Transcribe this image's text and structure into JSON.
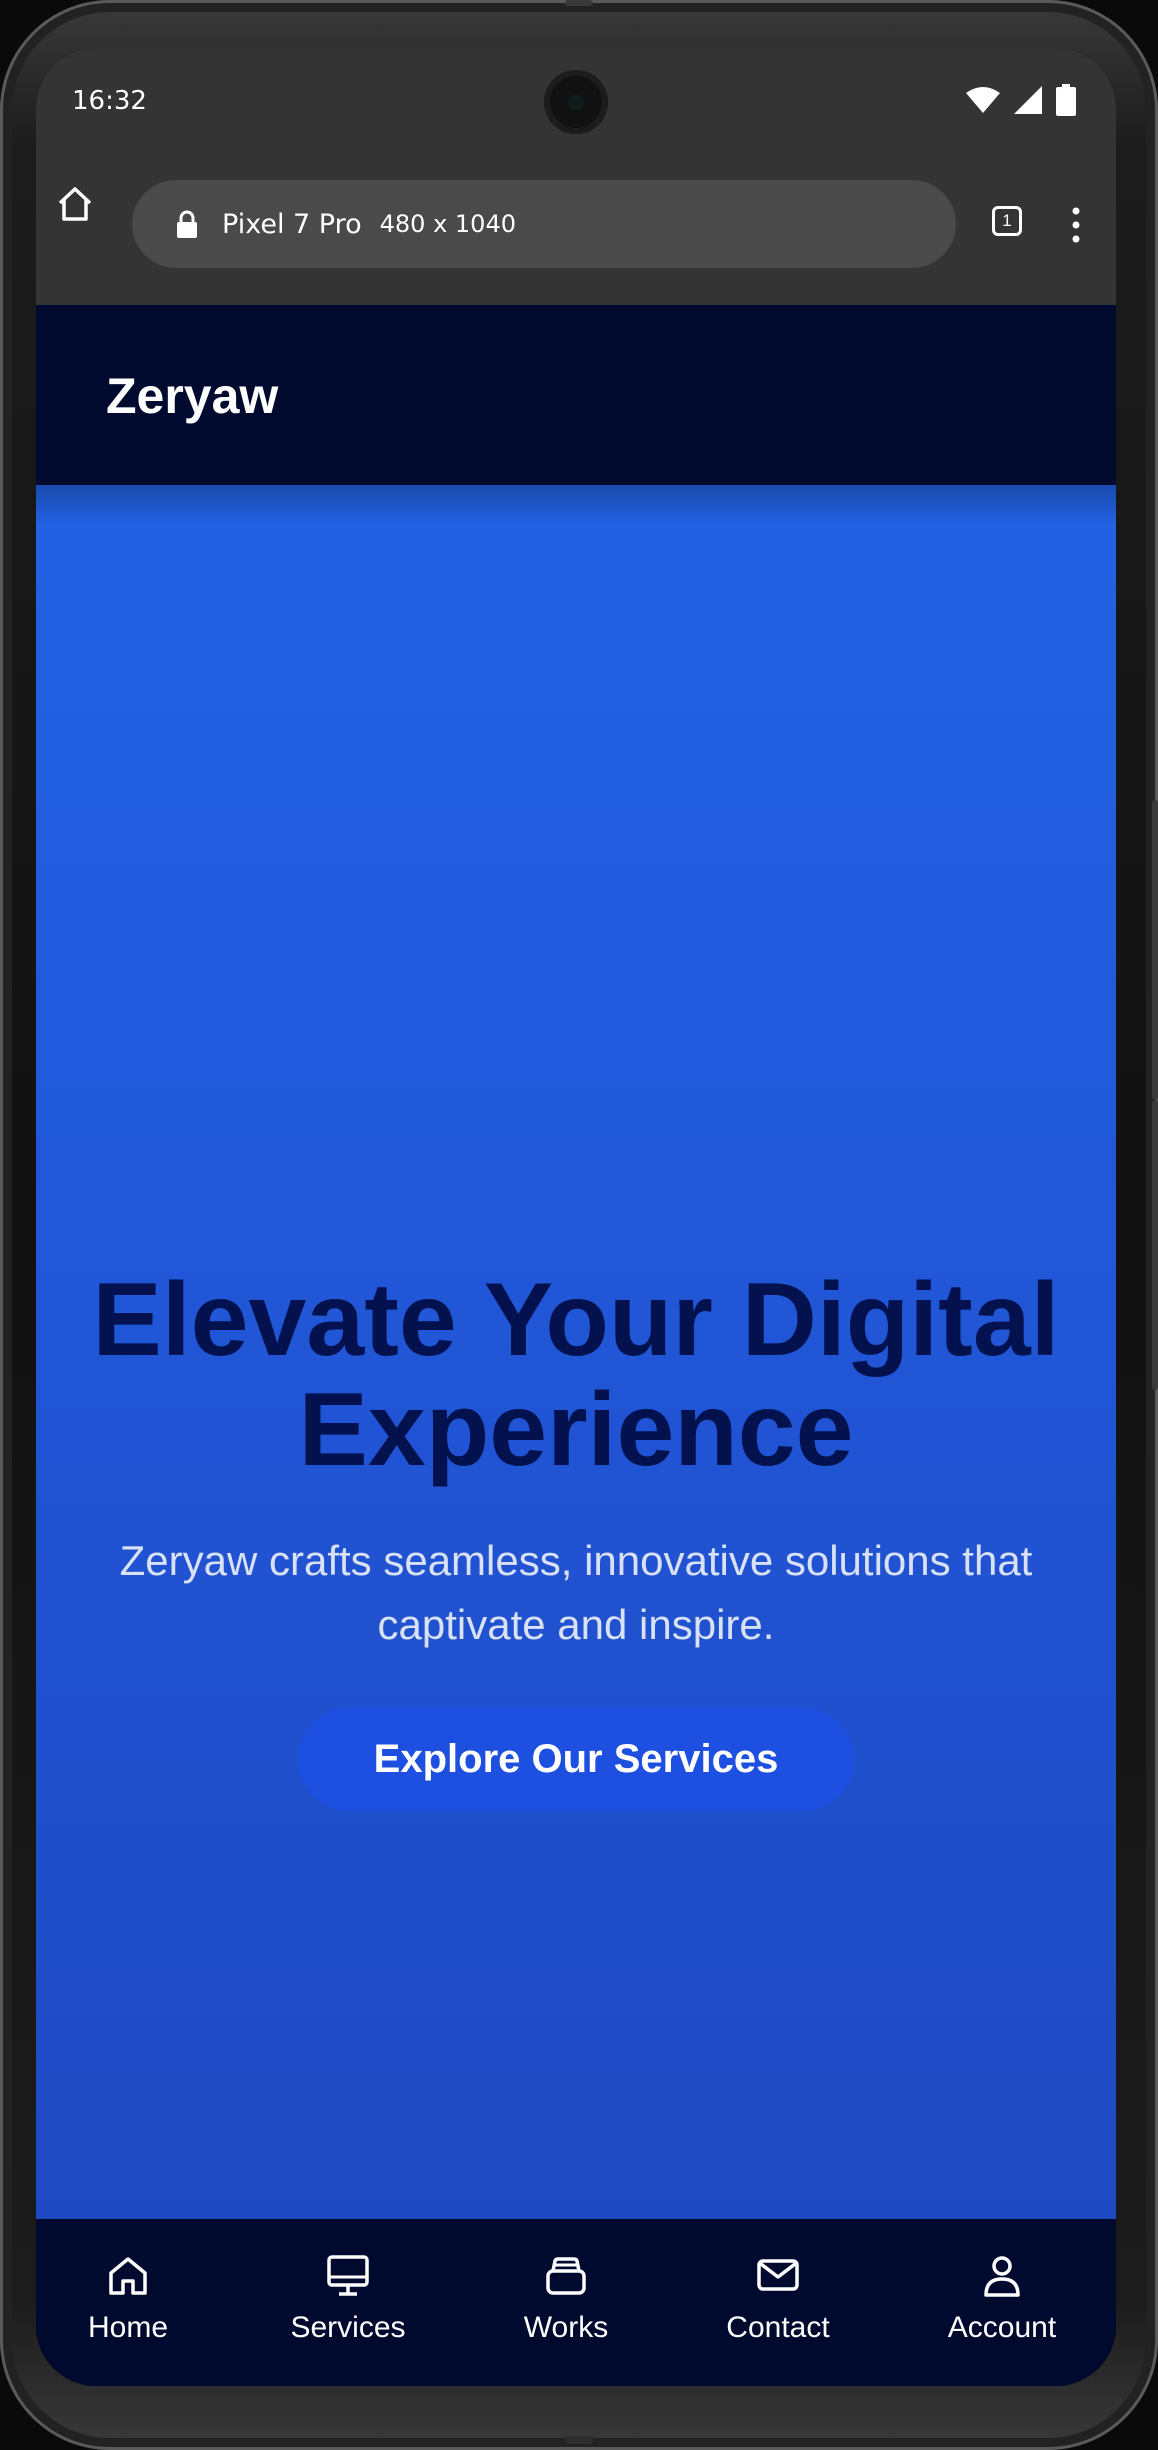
{
  "status_bar": {
    "time": "16:32"
  },
  "browser": {
    "device_name": "Pixel 7 Pro",
    "device_dims": "480 x 1040",
    "tab_count": "1"
  },
  "site": {
    "logo": "Zeryaw"
  },
  "hero": {
    "title_line1": "Elevate Your Digital",
    "title_line2": "Experience",
    "subtitle_line1": "Zeryaw crafts seamless, innovative solutions that",
    "subtitle_line2": "captivate and inspire.",
    "cta_label": "Explore Our Services"
  },
  "bottom_nav": {
    "items": [
      {
        "label": "Home",
        "icon": "home-icon"
      },
      {
        "label": "Services",
        "icon": "monitor-icon"
      },
      {
        "label": "Works",
        "icon": "briefcase-icon"
      },
      {
        "label": "Contact",
        "icon": "mail-icon"
      },
      {
        "label": "Account",
        "icon": "user-icon"
      }
    ]
  },
  "colors": {
    "header_bg": "#000a2e",
    "hero_top": "#2262e4",
    "hero_bottom": "#1f49c2",
    "hero_title": "#03124f",
    "cta_bg": "#1d4fe0"
  }
}
